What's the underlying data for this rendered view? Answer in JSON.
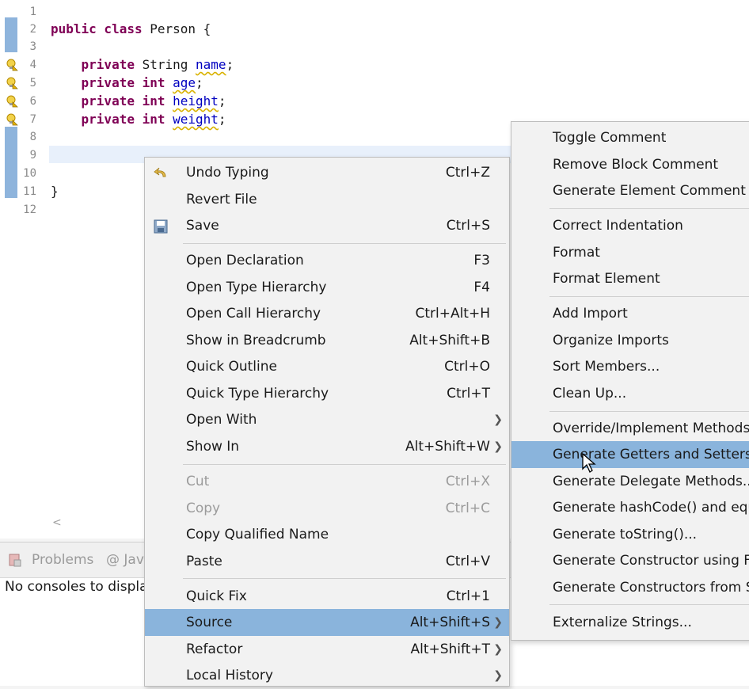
{
  "editor": {
    "lines": [
      {
        "n": "1",
        "code": ""
      },
      {
        "n": "2",
        "kw": "public class ",
        "rest": "Person {"
      },
      {
        "n": "3",
        "code": ""
      },
      {
        "n": "4",
        "kw": "private ",
        "type": "String ",
        "field": "name",
        "end": ";"
      },
      {
        "n": "5",
        "kw": "private int ",
        "field": "age",
        "end": ";"
      },
      {
        "n": "6",
        "kw": "private int ",
        "field": "height",
        "end": ";"
      },
      {
        "n": "7",
        "kw": "private int ",
        "field": "weight",
        "end": ";"
      },
      {
        "n": "8",
        "code": ""
      },
      {
        "n": "9",
        "code": ""
      },
      {
        "n": "10",
        "code": ""
      },
      {
        "n": "11",
        "code": "}"
      },
      {
        "n": "12",
        "code": ""
      }
    ],
    "scroll_arrow": "<"
  },
  "bottom_panel": {
    "tabs": [
      "Problems",
      "@ Jav"
    ],
    "message": "No consoles to displa"
  },
  "context_menu": {
    "items": [
      {
        "label": "Undo Typing",
        "shortcut": "Ctrl+Z",
        "icon": "undo-icon"
      },
      {
        "label": "Revert File",
        "shortcut": ""
      },
      {
        "label": "Save",
        "shortcut": "Ctrl+S",
        "icon": "save-icon"
      },
      {
        "label": "Open Declaration",
        "shortcut": "F3"
      },
      {
        "label": "Open Type Hierarchy",
        "shortcut": "F4"
      },
      {
        "label": "Open Call Hierarchy",
        "shortcut": "Ctrl+Alt+H"
      },
      {
        "label": "Show in Breadcrumb",
        "shortcut": "Alt+Shift+B"
      },
      {
        "label": "Quick Outline",
        "shortcut": "Ctrl+O"
      },
      {
        "label": "Quick Type Hierarchy",
        "shortcut": "Ctrl+T"
      },
      {
        "label": "Open With",
        "shortcut": ""
      },
      {
        "label": "Show In",
        "shortcut": "Alt+Shift+W"
      },
      {
        "label": "Cut",
        "shortcut": "Ctrl+X",
        "disabled": true
      },
      {
        "label": "Copy",
        "shortcut": "Ctrl+C",
        "disabled": true
      },
      {
        "label": "Copy Qualified Name",
        "shortcut": ""
      },
      {
        "label": "Paste",
        "shortcut": "Ctrl+V"
      },
      {
        "label": "Quick Fix",
        "shortcut": "Ctrl+1"
      },
      {
        "label": "Source",
        "shortcut": "Alt+Shift+S",
        "selected": true
      },
      {
        "label": "Refactor",
        "shortcut": "Alt+Shift+T"
      },
      {
        "label": "Local History",
        "shortcut": ""
      }
    ]
  },
  "source_submenu": {
    "items": [
      {
        "label": "Toggle Comment"
      },
      {
        "label": "Remove Block Comment"
      },
      {
        "label": "Generate Element Comment"
      },
      {
        "label": "Correct Indentation"
      },
      {
        "label": "Format"
      },
      {
        "label": "Format Element"
      },
      {
        "label": "Add Import"
      },
      {
        "label": "Organize Imports"
      },
      {
        "label": "Sort Members..."
      },
      {
        "label": "Clean Up..."
      },
      {
        "label": "Override/Implement Methods..."
      },
      {
        "label": "Generate Getters and Setters...",
        "selected": true
      },
      {
        "label": "Generate Delegate Methods..."
      },
      {
        "label": "Generate hashCode() and equa"
      },
      {
        "label": "Generate toString()..."
      },
      {
        "label": "Generate Constructor using Fie"
      },
      {
        "label": "Generate Constructors from Su"
      },
      {
        "label": "Externalize Strings..."
      }
    ]
  },
  "colors": {
    "keyword": "#7f0055",
    "field": "#0000c0",
    "highlight": "#8ab4dc",
    "ruler": "#7aa7d6"
  }
}
